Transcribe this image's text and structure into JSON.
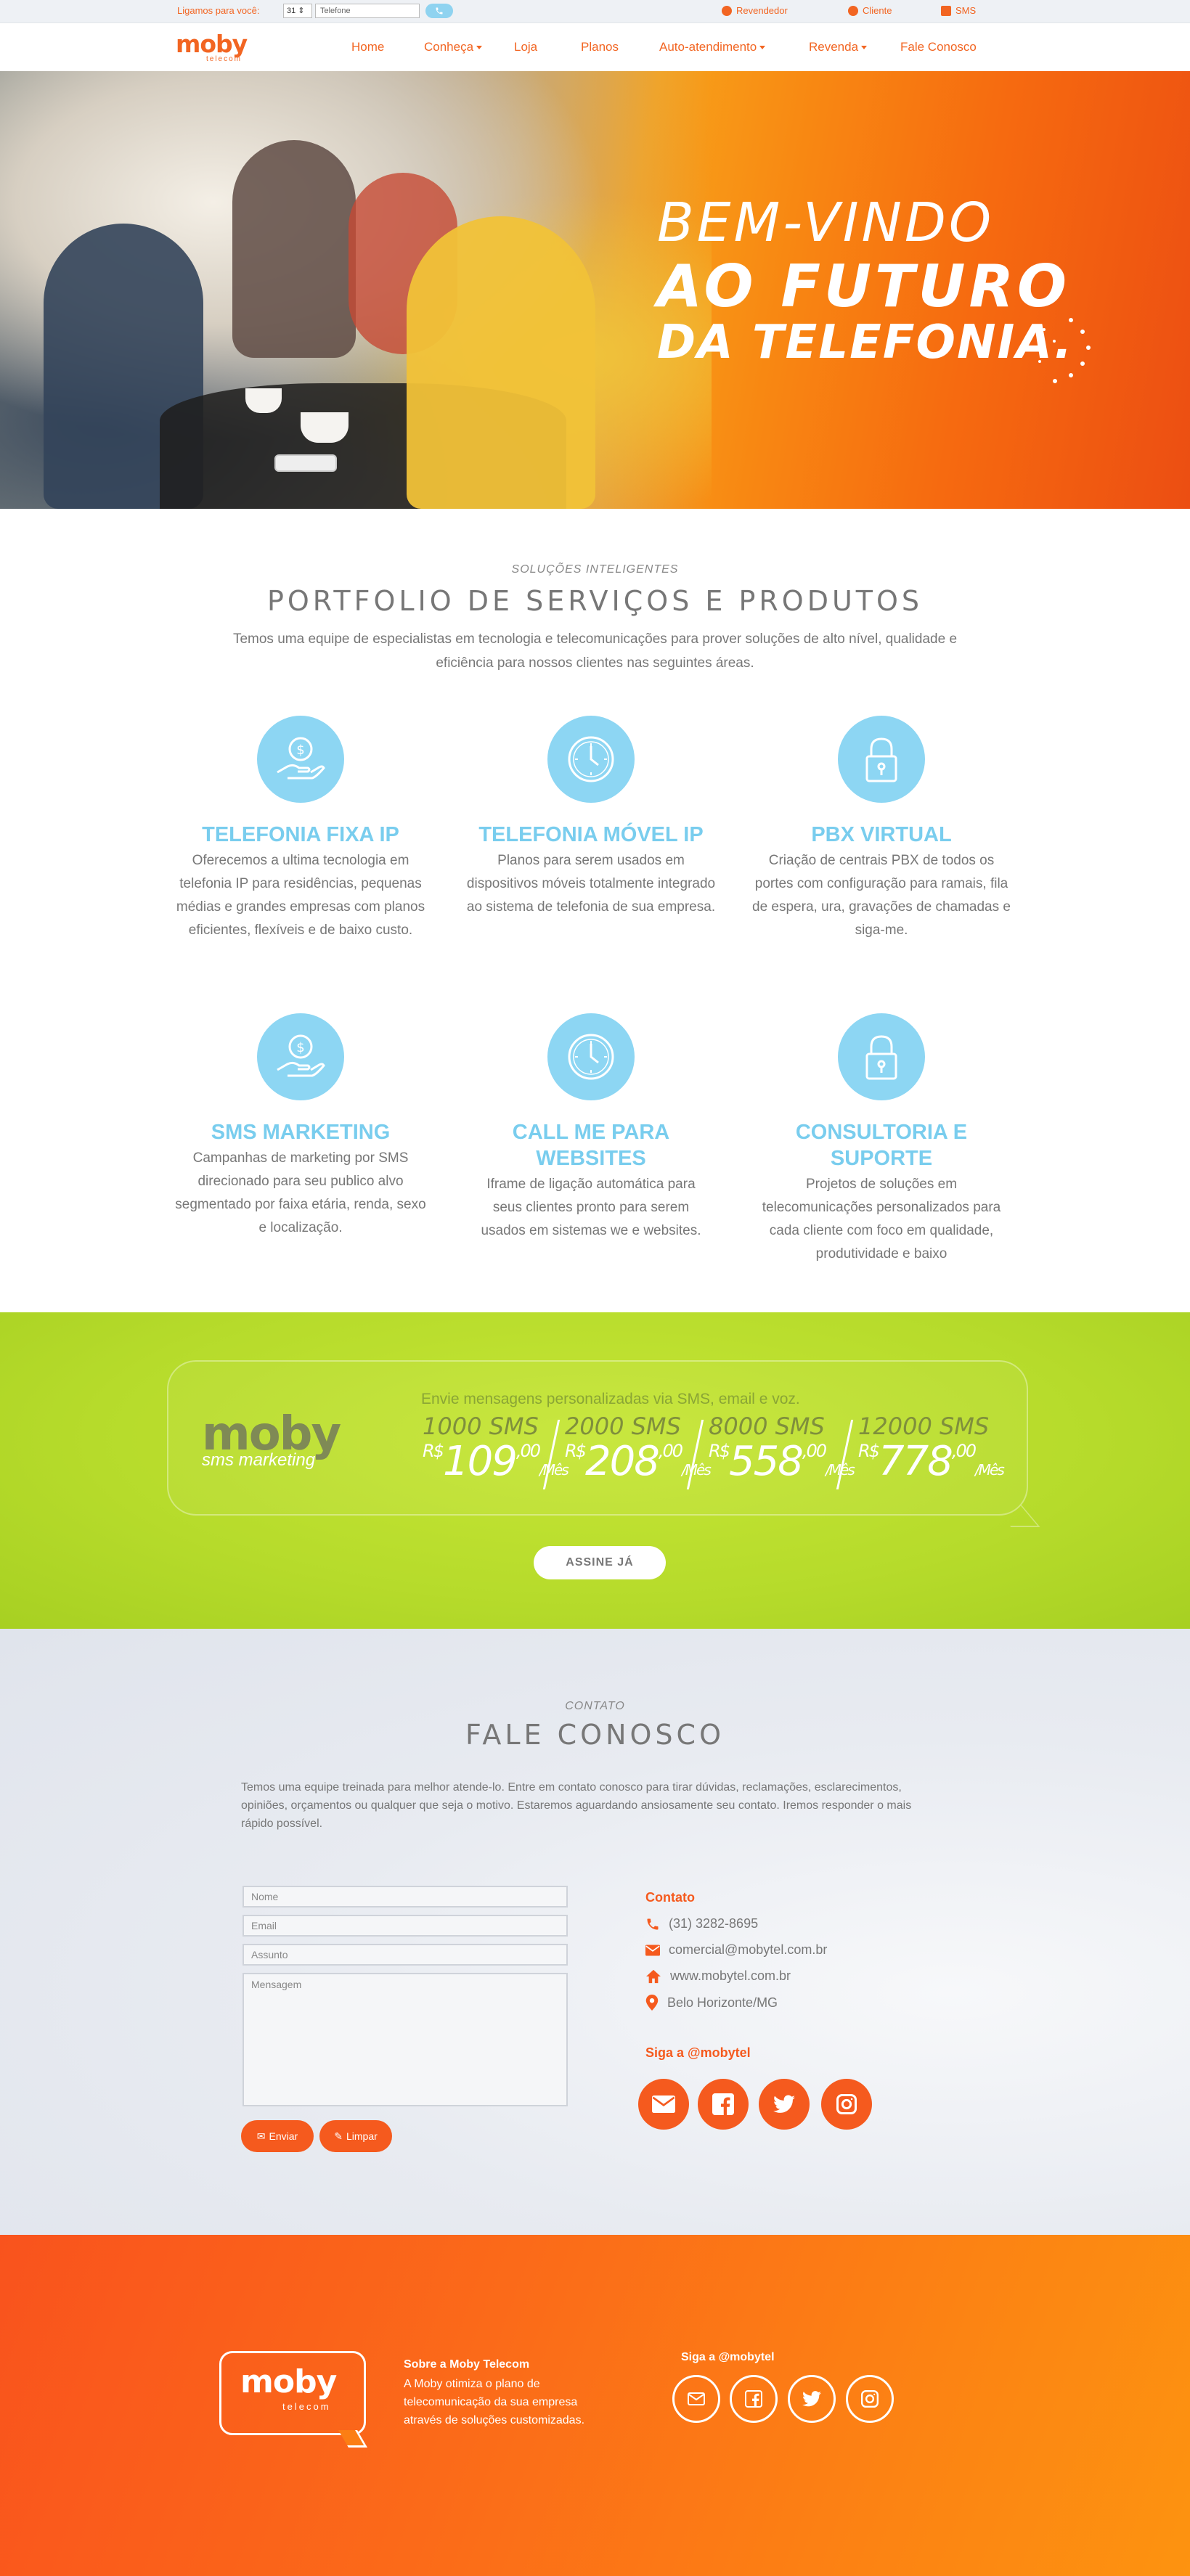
{
  "topbar": {
    "call_label": "Ligamos para você:",
    "ddd_value": "31",
    "phone_placeholder": "Telefone",
    "links": [
      "Revendedor",
      "Cliente",
      "SMS"
    ]
  },
  "nav": {
    "logo_main": "moby",
    "logo_sub": "telecom",
    "items": [
      "Home",
      "Conheça",
      "Loja",
      "Planos",
      "Auto-atendimento",
      "Revenda",
      "Fale Conosco"
    ]
  },
  "hero": {
    "line1": "BEM-VINDO",
    "line2": "AO FUTURO",
    "line3": "DA TELEFONIA."
  },
  "portfolio": {
    "kicker": "SOLUÇÕES INTELIGENTES",
    "title": "PORTFOLIO DE SERVIÇOS E PRODUTOS",
    "description": "Temos uma equipe de especialistas em tecnologia e telecomunicações para prover soluções de alto nível, qualidade e eficiência para nossos clientes nas seguintes áreas.",
    "cards": [
      {
        "title": "TELEFONIA FIXA IP",
        "text": "Oferecemos a ultima tecnologia em telefonia IP para residências, pequenas médias e grandes empresas com planos eficientes, flexíveis e de baixo custo.",
        "icon": "money-hand-icon"
      },
      {
        "title": "TELEFONIA MÓVEL IP",
        "text": "Planos para serem usados em dispositivos móveis totalmente integrado ao sistema de telefonia de sua empresa.",
        "icon": "clock-icon"
      },
      {
        "title": "PBX VIRTUAL",
        "text": "Criação de centrais PBX de todos os portes com configuração para ramais, fila de espera, ura, gravações de chamadas e siga-me.",
        "icon": "lock-icon"
      },
      {
        "title": "SMS MARKETING",
        "text": "Campanhas de marketing por SMS direcionado para seu publico alvo segmentado por faixa etária, renda, sexo e localização.",
        "icon": "money-hand-icon"
      },
      {
        "title": "CALL ME PARA WEBSITES",
        "text": "Iframe de ligação automática para seus clientes pronto para serem usados em sistemas we e websites.",
        "icon": "clock-icon"
      },
      {
        "title": "CONSULTORIA E SUPORTE",
        "text": "Projetos de soluções em telecomunicações personalizados para cada cliente com foco em qualidade, produtividade e baixo",
        "icon": "lock-icon"
      }
    ]
  },
  "sms": {
    "logo_main": "moby",
    "logo_tag": "sms marketing",
    "headline": "Envie mensagens personalizadas via SMS, email e voz.",
    "currency": "R$",
    "per_month": "/Mês",
    "plans": [
      {
        "qty": "1000 SMS",
        "price": "109",
        "cents": ",00"
      },
      {
        "qty": "2000 SMS",
        "price": "208",
        "cents": ",00"
      },
      {
        "qty": "8000 SMS",
        "price": "558",
        "cents": ",00"
      },
      {
        "qty": "12000 SMS",
        "price": "778",
        "cents": ",00"
      }
    ],
    "cta": "ASSINE JÁ"
  },
  "contact": {
    "kicker": "CONTATO",
    "title": "FALE CONOSCO",
    "description": "Temos uma equipe treinada para melhor atende-lo. Entre em contato conosco para tirar dúvidas, reclamações, esclarecimentos, opiniões, orçamentos ou qualquer que seja o motivo. Estaremos aguardando ansiosamente seu contato. Iremos responder o mais rápido possível.",
    "form": {
      "name_placeholder": "Nome",
      "email_placeholder": "Email",
      "subject_placeholder": "Assunto",
      "message_placeholder": "Mensagem",
      "send_label": "Enviar",
      "clear_label": "Limpar"
    },
    "info_title": "Contato",
    "phone": "(31) 3282-8695",
    "email": "comercial@mobytel.com.br",
    "website": "www.mobytel.com.br",
    "location": "Belo Horizonte/MG",
    "social_title": "Siga a @mobytel"
  },
  "footer": {
    "logo_main": "moby",
    "logo_sub": "telecom",
    "about_title": "Sobre a Moby Telecom",
    "about_text": "A Moby otimiza o plano de telecomunicação da sua empresa através de soluções customizadas.",
    "social_title": "Siga a @mobytel"
  },
  "colors": {
    "brand_orange": "#f26522",
    "accent_blue": "#79cdee",
    "sms_green": "#b6db2b"
  }
}
